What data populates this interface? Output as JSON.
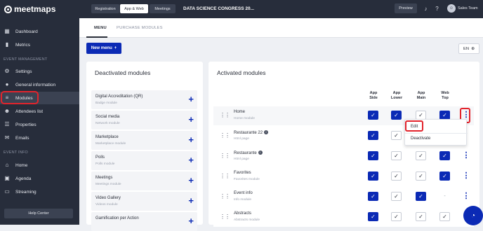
{
  "brand": {
    "name": "meetmaps"
  },
  "sidebar": {
    "items_top": [
      {
        "label": "Dashboard",
        "icon": "dashboard-icon"
      },
      {
        "label": "Metrics",
        "icon": "bar-chart-icon"
      }
    ],
    "section_event_management": "EVENT MANAGEMENT",
    "items_management": [
      {
        "label": "Settings",
        "icon": "gear-icon"
      },
      {
        "label": "General information",
        "icon": "info-icon"
      },
      {
        "label": "Modules",
        "icon": "menu-icon"
      },
      {
        "label": "Attendees list",
        "icon": "people-icon"
      },
      {
        "label": "Properties",
        "icon": "list-icon"
      },
      {
        "label": "Emails",
        "icon": "mail-icon"
      }
    ],
    "section_event_info": "EVENT INFO",
    "items_info": [
      {
        "label": "Home",
        "icon": "home-icon"
      },
      {
        "label": "Agenda",
        "icon": "calendar-icon"
      },
      {
        "label": "Streaming",
        "icon": "cast-icon"
      }
    ],
    "help_label": "Help Center"
  },
  "topbar": {
    "tabs": [
      "Registration",
      "App & Web",
      "Meetings"
    ],
    "event_title": "DATA SCIENCE CONGRESS 20...",
    "preview_label": "Preview",
    "user_name": "Sales Team"
  },
  "subtabs": [
    "MENU",
    "PURCHASE MODULES"
  ],
  "new_menu_label": "New menu",
  "language": "EN",
  "deactivated": {
    "title": "Deactivated modules",
    "items": [
      {
        "name": "Digital Accreditation (QR)",
        "sub": "Badge module"
      },
      {
        "name": "Social media",
        "sub": "Network module"
      },
      {
        "name": "Marketplace",
        "sub": "Marketplace module"
      },
      {
        "name": "Polls",
        "sub": "Polls module"
      },
      {
        "name": "Meetings",
        "sub": "Meetings module"
      },
      {
        "name": "Video Gallery",
        "sub": "Videos module"
      },
      {
        "name": "Gamification per Action",
        "sub": ""
      }
    ]
  },
  "activated": {
    "title": "Activated modules",
    "columns": [
      {
        "line1": "App",
        "line2": "Side"
      },
      {
        "line1": "App",
        "line2": "Lower"
      },
      {
        "line1": "App",
        "line2": "Main"
      },
      {
        "line1": "Web",
        "line2": "Top"
      }
    ],
    "rows": [
      {
        "name": "Home",
        "sub": "Home module",
        "info": false,
        "states": [
          "on",
          "on",
          "off",
          "on"
        ]
      },
      {
        "name": "Restaurante 22",
        "sub": "Html page",
        "info": true,
        "states": [
          "on",
          "off",
          "on",
          "on"
        ]
      },
      {
        "name": "Restaurante",
        "sub": "Html page",
        "info": true,
        "states": [
          "on",
          "off",
          "off",
          "on"
        ]
      },
      {
        "name": "Favorites",
        "sub": "Favorites module",
        "info": false,
        "states": [
          "on",
          "off",
          "off",
          "on"
        ]
      },
      {
        "name": "Event info",
        "sub": "Info module",
        "info": false,
        "states": [
          "on",
          "off",
          "on",
          "none"
        ]
      },
      {
        "name": "Abstracts",
        "sub": "Abstracts module",
        "info": false,
        "states": [
          "on",
          "off",
          "off",
          "off"
        ]
      }
    ],
    "none_glyph": "-"
  },
  "dropdown": {
    "edit": "Edit",
    "deactivate": "Deactivate"
  },
  "glyphs": {
    "check": "✓",
    "plus": "+",
    "kebab": "⋮",
    "info": "i",
    "drag": "⋮⋮",
    "globe": "⊕"
  }
}
